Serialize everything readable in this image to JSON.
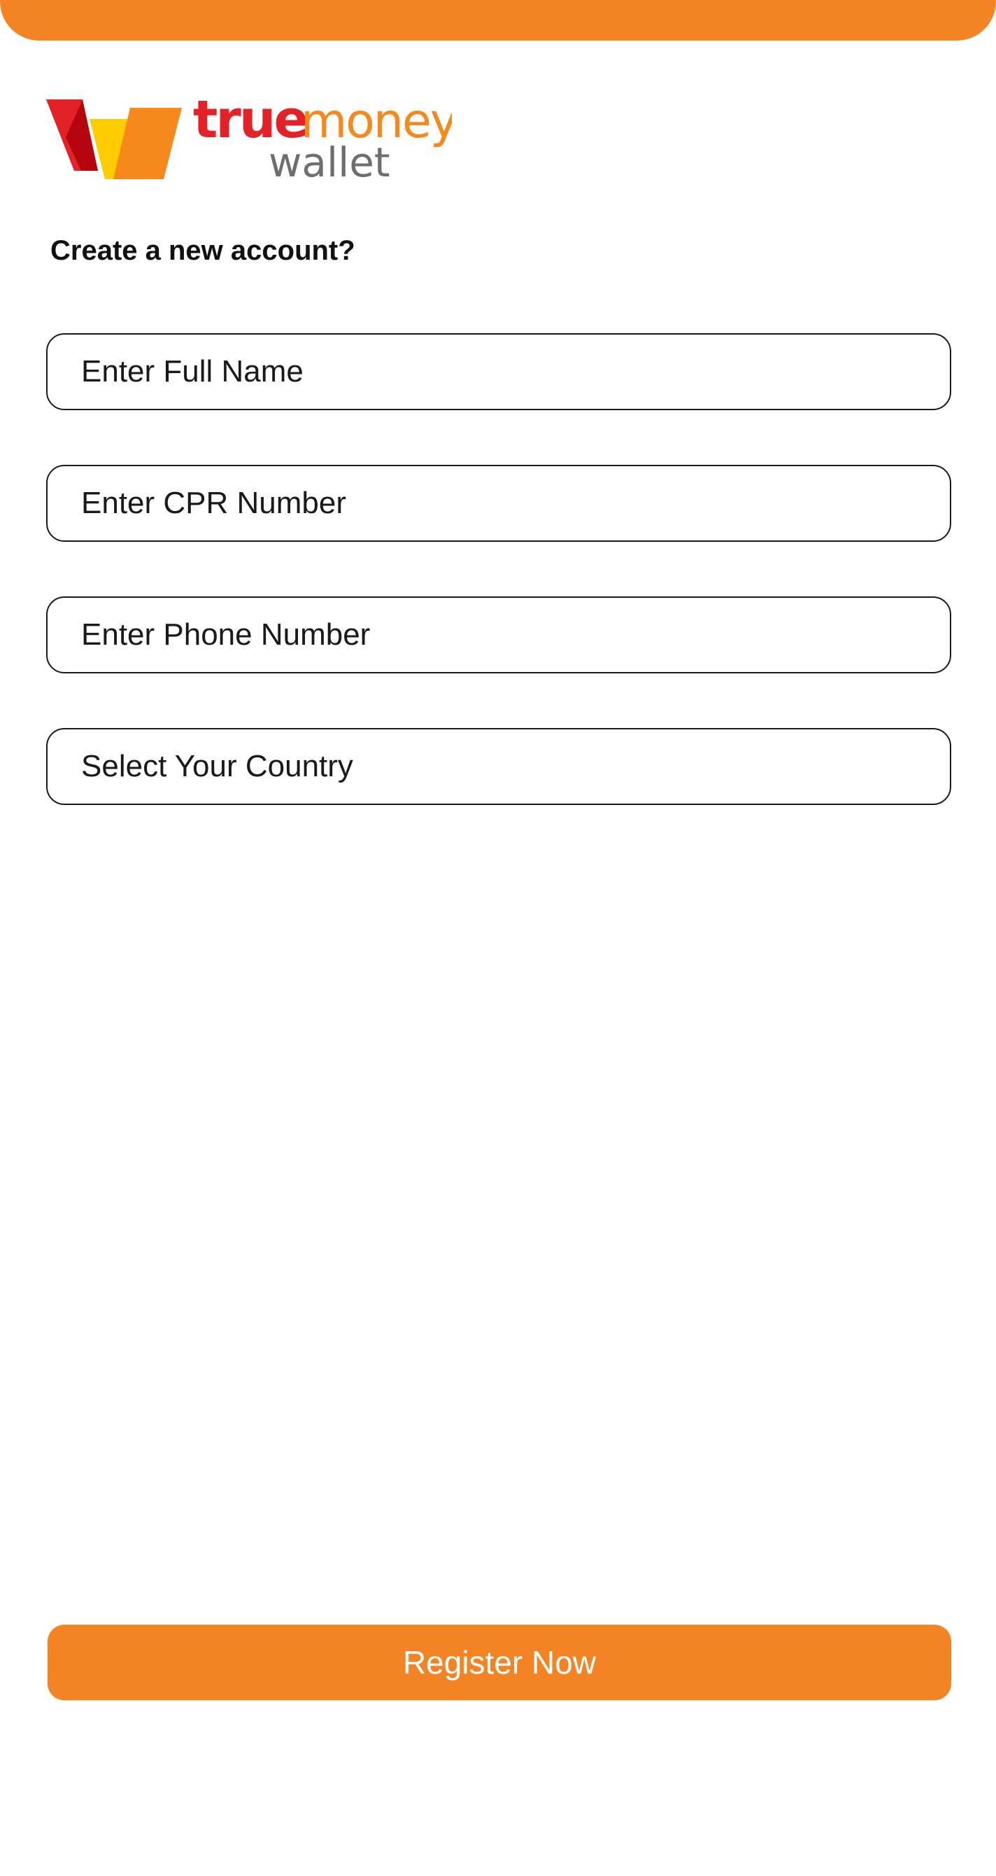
{
  "theme": {
    "accent_color": "#F48423",
    "logo_red": "#E32228",
    "logo_dark_red": "#B5060F",
    "logo_yellow": "#FFCC00",
    "logo_orange": "#F7891C",
    "logo_gray": "#6E6E70"
  },
  "brand": {
    "logo_word_true": "true",
    "logo_word_money": "money",
    "logo_word_wallet": "wallet"
  },
  "form": {
    "title": "Create a new account?",
    "full_name_placeholder": "Enter Full Name",
    "cpr_placeholder": "Enter CPR Number",
    "phone_placeholder": "Enter Phone Number",
    "country_placeholder": "Select Your Country"
  },
  "actions": {
    "register_label": "Register Now"
  }
}
